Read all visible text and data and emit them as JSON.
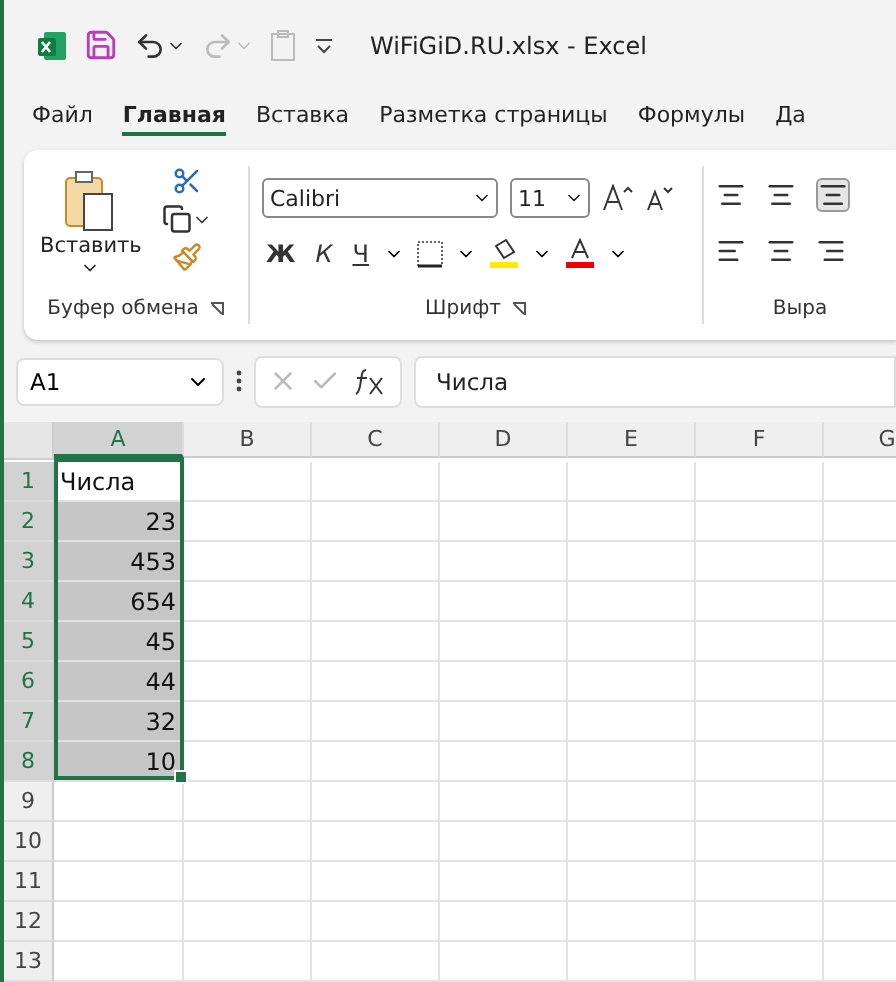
{
  "window": {
    "title": "WiFiGiD.RU.xlsx  -  Excel"
  },
  "tabs": [
    {
      "label": "Файл",
      "selected": false
    },
    {
      "label": "Главная",
      "selected": true
    },
    {
      "label": "Вставка",
      "selected": false
    },
    {
      "label": "Разметка страницы",
      "selected": false
    },
    {
      "label": "Формулы",
      "selected": false
    },
    {
      "label": "Да",
      "selected": false
    }
  ],
  "ribbon": {
    "clipboard": {
      "paste_label": "Вставить",
      "group_label": "Буфер обмена"
    },
    "font": {
      "font_name": "Calibri",
      "font_size": "11",
      "bold": "Ж",
      "italic": "К",
      "underline": "Ч",
      "group_label": "Шрифт"
    },
    "alignment": {
      "group_label": "Выра"
    }
  },
  "formula_bar": {
    "name_box": "A1",
    "formula": "Числа"
  },
  "columns": [
    {
      "label": "A",
      "selected": true
    },
    {
      "label": "B",
      "selected": false
    },
    {
      "label": "C",
      "selected": false
    },
    {
      "label": "D",
      "selected": false
    },
    {
      "label": "E",
      "selected": false
    },
    {
      "label": "F",
      "selected": false
    },
    {
      "label": "G",
      "selected": false
    }
  ],
  "rows": [
    {
      "number": "1",
      "selected": true,
      "cell": {
        "text": "Числа",
        "kind": "text",
        "selected": true,
        "active": true
      }
    },
    {
      "number": "2",
      "selected": true,
      "cell": {
        "text": "23",
        "kind": "number",
        "selected": true,
        "active": false
      }
    },
    {
      "number": "3",
      "selected": true,
      "cell": {
        "text": "453",
        "kind": "number",
        "selected": true,
        "active": false
      }
    },
    {
      "number": "4",
      "selected": true,
      "cell": {
        "text": "654",
        "kind": "number",
        "selected": true,
        "active": false
      }
    },
    {
      "number": "5",
      "selected": true,
      "cell": {
        "text": "45",
        "kind": "number",
        "selected": true,
        "active": false
      }
    },
    {
      "number": "6",
      "selected": true,
      "cell": {
        "text": "44",
        "kind": "number",
        "selected": true,
        "active": false
      }
    },
    {
      "number": "7",
      "selected": true,
      "cell": {
        "text": "32",
        "kind": "number",
        "selected": true,
        "active": false
      }
    },
    {
      "number": "8",
      "selected": true,
      "cell": {
        "text": "10",
        "kind": "number",
        "selected": true,
        "active": false
      }
    },
    {
      "number": "9",
      "selected": false
    },
    {
      "number": "10",
      "selected": false
    },
    {
      "number": "11",
      "selected": false
    },
    {
      "number": "12",
      "selected": false
    },
    {
      "number": "13",
      "selected": false
    }
  ]
}
